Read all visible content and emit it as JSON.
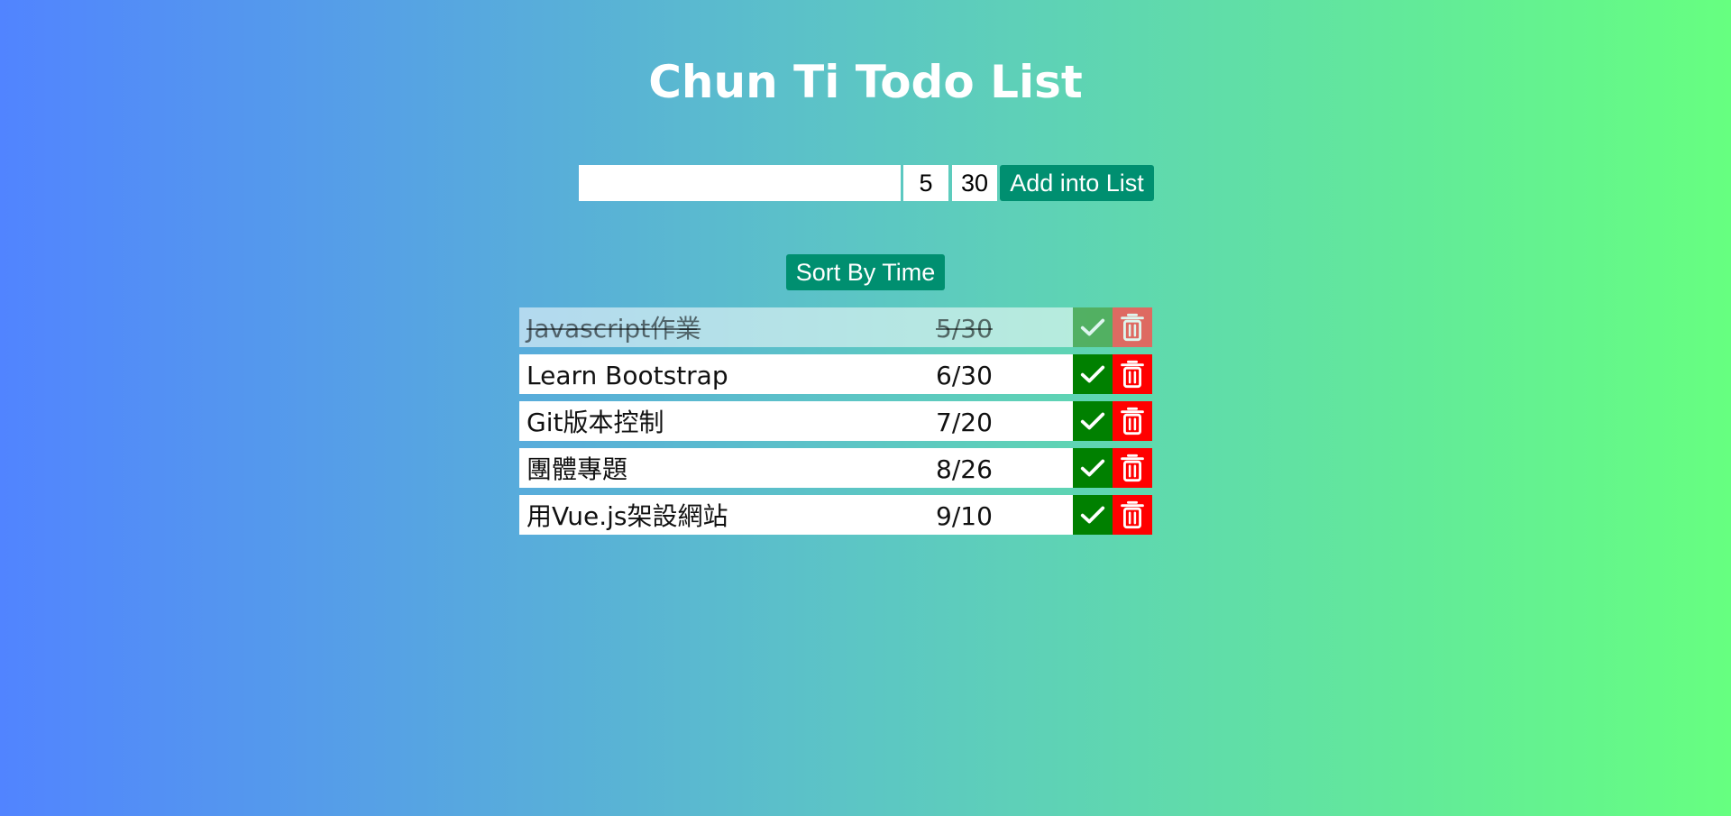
{
  "app": {
    "title": "Chun Ti Todo List"
  },
  "form": {
    "task_value": "",
    "month_value": "5",
    "day_value": "30",
    "add_label": "Add into List"
  },
  "sort": {
    "label": "Sort By Time"
  },
  "todos": [
    {
      "text": "Javascript作業",
      "date": "5/30",
      "done": true
    },
    {
      "text": "Learn Bootstrap",
      "date": "6/30",
      "done": false
    },
    {
      "text": "Git版本控制",
      "date": "7/20",
      "done": false
    },
    {
      "text": "團體專題",
      "date": "8/26",
      "done": false
    },
    {
      "text": "用Vue.js架設網站",
      "date": "9/10",
      "done": false
    }
  ],
  "icons": {
    "complete": "check-icon",
    "delete": "trash-icon"
  },
  "colors": {
    "accent": "#008f70",
    "complete": "#008000",
    "delete": "#ff0000"
  }
}
